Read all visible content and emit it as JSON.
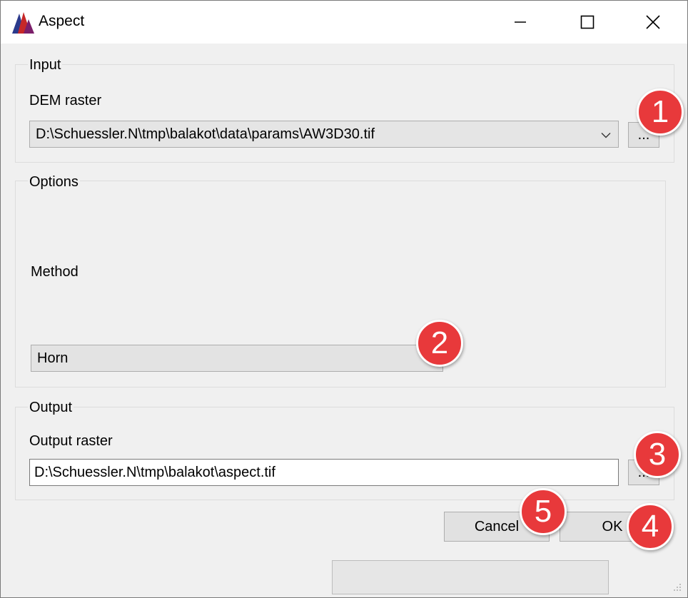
{
  "window": {
    "title": "Aspect",
    "icon": "qgis-processing-logo",
    "controls": {
      "minimize": "minimize-icon",
      "maximize": "maximize-icon",
      "close": "close-icon"
    }
  },
  "input": {
    "group_title": "Input",
    "dem_label": "DEM raster",
    "dem_value": "D:\\Schuessler.N\\tmp\\balakot\\data\\params\\AW3D30.tif",
    "browse_label": "..."
  },
  "options": {
    "group_title": "Options",
    "method_label": "Method",
    "method_value": "Horn"
  },
  "output": {
    "group_title": "Output",
    "raster_label": "Output raster",
    "raster_value": "D:\\Schuessler.N\\tmp\\balakot\\aspect.tif",
    "browse_label": "..."
  },
  "buttons": {
    "cancel": "Cancel",
    "ok": "OK"
  },
  "badges": [
    "1",
    "2",
    "3",
    "4",
    "5"
  ],
  "colors": {
    "badge": "#e8393b",
    "titlebar": "#ffffff",
    "dialog_bg": "#f0f0f0"
  }
}
